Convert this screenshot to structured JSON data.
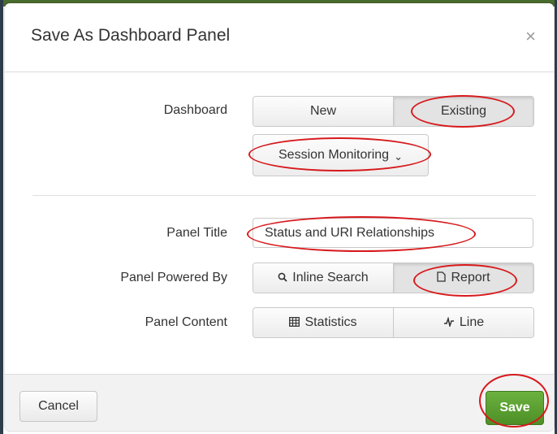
{
  "dialog": {
    "title": "Save As Dashboard Panel",
    "close_symbol": "×"
  },
  "dashboard": {
    "label": "Dashboard",
    "options": [
      "New",
      "Existing"
    ],
    "selected": "Existing",
    "dropdown_value": "Session Monitoring",
    "dropdown_icon": "chevron-down-icon"
  },
  "panel_title": {
    "label": "Panel Title",
    "value": "Status and URI Relationships"
  },
  "panel_powered_by": {
    "label": "Panel Powered By",
    "options": [
      {
        "icon": "search-icon",
        "label": "Inline Search"
      },
      {
        "icon": "document-icon",
        "label": "Report"
      }
    ],
    "selected": "Report"
  },
  "panel_content": {
    "label": "Panel Content",
    "options": [
      {
        "icon": "table-icon",
        "label": "Statistics"
      },
      {
        "icon": "line-chart-icon",
        "label": "Line"
      }
    ]
  },
  "footer": {
    "cancel_label": "Cancel",
    "save_label": "Save"
  },
  "colors": {
    "save_button": "#5aa032",
    "annotation": "#d7191c",
    "backdrop_top": "#4a6b2e"
  }
}
